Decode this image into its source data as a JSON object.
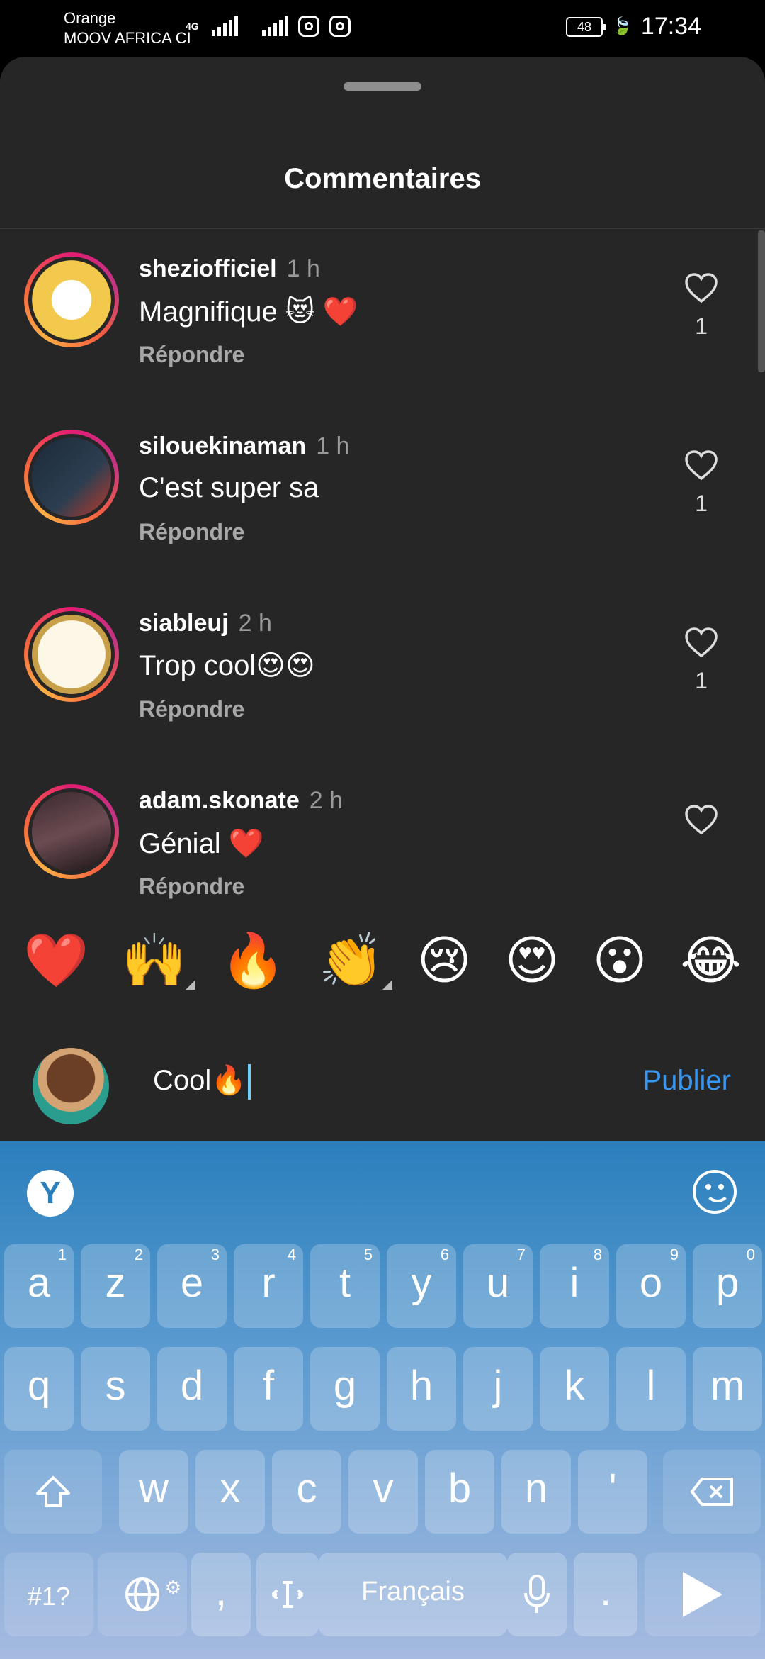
{
  "status_bar": {
    "carrier_line1": "Orange",
    "carrier_line2": "MOOV AFRICA CI",
    "network": "4G",
    "battery": "48",
    "time": "17:34"
  },
  "sheet": {
    "title": "Commentaires"
  },
  "comments": [
    {
      "username": "sheziofficiel",
      "time": "1 h",
      "text": "Magnifique 😻 ❤️",
      "reply": "Répondre",
      "likes": "1"
    },
    {
      "username": "silouekinaman",
      "time": "1 h",
      "text": "C'est super sa",
      "reply": "Répondre",
      "likes": "1"
    },
    {
      "username": "siableuj",
      "time": "2 h",
      "text": "Trop cool😍😍",
      "reply": "Répondre",
      "likes": "1"
    },
    {
      "username": "adam.skonate",
      "time": "2 h",
      "text": "Génial ❤️",
      "reply": "Répondre",
      "likes": ""
    }
  ],
  "quick_emojis": [
    "❤️",
    "🙌",
    "🔥",
    "👏",
    "😢",
    "😍",
    "😮",
    "😂"
  ],
  "compose": {
    "value": "Cool🔥",
    "publish_label": "Publier"
  },
  "keyboard": {
    "row1": [
      {
        "k": "a",
        "n": "1"
      },
      {
        "k": "z",
        "n": "2"
      },
      {
        "k": "e",
        "n": "3"
      },
      {
        "k": "r",
        "n": "4"
      },
      {
        "k": "t",
        "n": "5"
      },
      {
        "k": "y",
        "n": "6"
      },
      {
        "k": "u",
        "n": "7"
      },
      {
        "k": "i",
        "n": "8"
      },
      {
        "k": "o",
        "n": "9"
      },
      {
        "k": "p",
        "n": "0"
      }
    ],
    "row2": [
      "q",
      "s",
      "d",
      "f",
      "g",
      "h",
      "j",
      "k",
      "l",
      "m"
    ],
    "row3": [
      "w",
      "x",
      "c",
      "v",
      "b",
      "n",
      "'"
    ],
    "symbols_label": "#1?",
    "comma": ",",
    "space_label": "Français",
    "period": ".",
    "logo_letter": "Y"
  },
  "colors": {
    "accent": "#3897f0",
    "sheet_bg": "#262626",
    "like_red": "#ed4956"
  }
}
